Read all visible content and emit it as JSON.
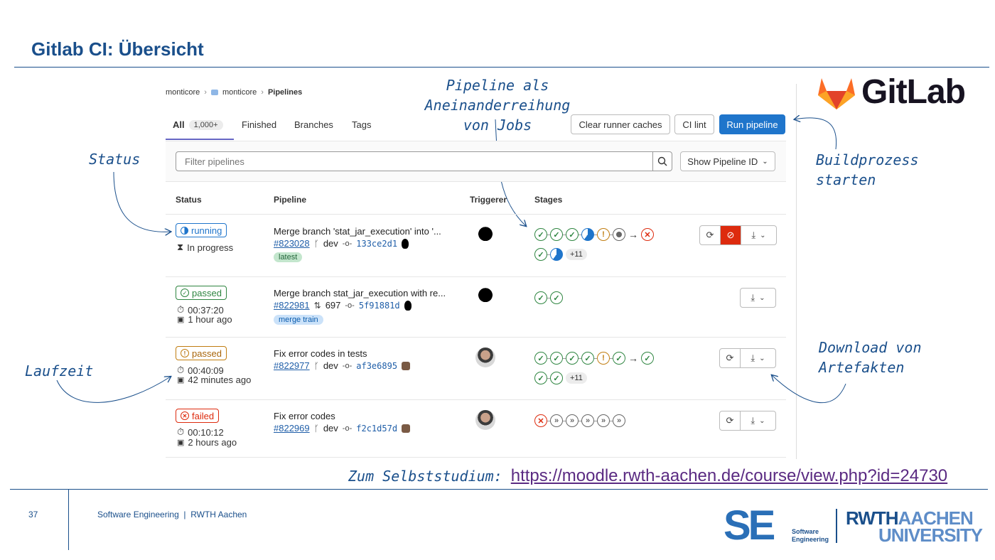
{
  "slide": {
    "title": "Gitlab CI: Übersicht",
    "page_number": "37",
    "footer_text": "Software Engineering  |  RWTH Aachen",
    "study_label": "Zum Selbststudium:",
    "study_link": "https://moodle.rwth-aachen.de/course/view.php?id=24730",
    "gitlab_logo_text": "GitLab",
    "se_logo": {
      "letters": "SE",
      "sub1": "Software",
      "sub2": "Engineering"
    },
    "rwth_logo": {
      "line1a": "RWTH",
      "line1b": "AACHEN",
      "line2": "UNIVERSITY"
    }
  },
  "annotations": {
    "status": "Status",
    "laufzeit": "Laufzeit",
    "pipeline_line1": "Pipeline als Aneinanderreihung",
    "pipeline_line2": "von Jobs",
    "build_line1": "Buildprozess",
    "build_line2": "starten",
    "download_line1": "Download von",
    "download_line2": "Artefakten"
  },
  "breadcrumb": {
    "item1": "monticore",
    "item2": "monticore",
    "item3": "Pipelines"
  },
  "tabs": {
    "all": "All",
    "all_count": "1,000+",
    "finished": "Finished",
    "branches": "Branches",
    "tags": "Tags"
  },
  "buttons": {
    "clear_cache": "Clear runner caches",
    "ci_lint": "CI lint",
    "run_pipeline": "Run pipeline"
  },
  "filter": {
    "placeholder": "Filter pipelines",
    "dropdown": "Show Pipeline ID"
  },
  "table": {
    "headers": {
      "status": "Status",
      "pipeline": "Pipeline",
      "triggerer": "Triggerer",
      "stages": "Stages"
    },
    "rows": [
      {
        "status": "running",
        "line1": "In progress",
        "line2": "",
        "title": "Merge branch 'stat_jar_execution' into '...",
        "id": "#823028",
        "ref": "dev",
        "sha": "133ce2d1",
        "tag": "latest",
        "more": "+11"
      },
      {
        "status": "passed",
        "line1": "00:37:20",
        "line2": "1 hour ago",
        "title": "Merge branch stat_jar_execution with re...",
        "id": "#822981",
        "ref": "697",
        "sha": "5f91881d",
        "tag": "merge train",
        "more": ""
      },
      {
        "status": "passed",
        "line1": "00:40:09",
        "line2": "42 minutes ago",
        "title": "Fix error codes in tests",
        "id": "#822977",
        "ref": "dev",
        "sha": "af3e6895",
        "tag": "",
        "more": "+11"
      },
      {
        "status": "failed",
        "line1": "00:10:12",
        "line2": "2 hours ago",
        "title": "Fix error codes",
        "id": "#822969",
        "ref": "dev",
        "sha": "f2c1d57d",
        "tag": "",
        "more": ""
      }
    ]
  },
  "icons": {
    "running": "running-icon",
    "passed": "check-circle-icon",
    "warning": "warning-icon",
    "failed": "x-circle-icon",
    "retry": "retry-icon",
    "cancel": "cancel-icon",
    "download": "download-icon"
  },
  "colors": {
    "title_blue": "#1a4f8b",
    "primary": "#1f75cb",
    "success": "#2e8540",
    "warning": "#c17d10",
    "danger": "#dd2b0e",
    "link": "#5a2a82"
  }
}
